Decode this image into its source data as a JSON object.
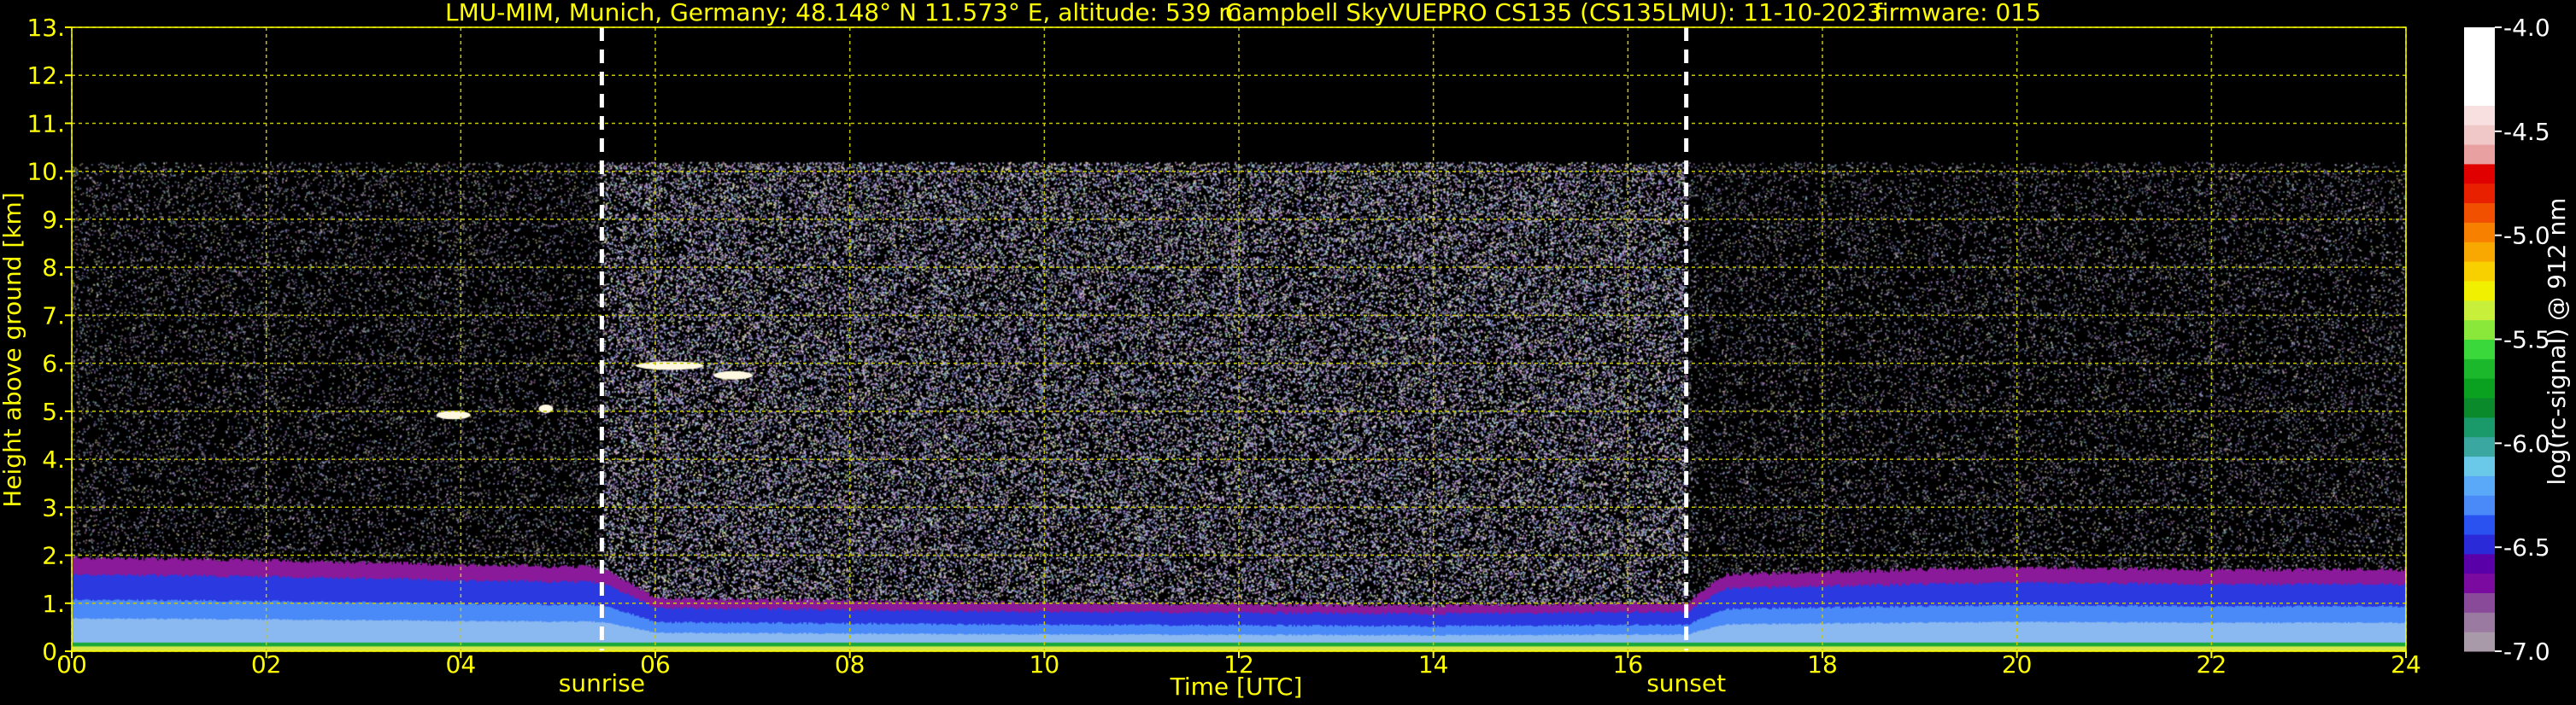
{
  "chart_data": {
    "type": "heatmap",
    "title": {
      "location": "LMU-MIM, Munich, Germany; 48.148° N 11.573° E, altitude: 539 m",
      "instrument": "Campbell SkyVUEPRO CS135 (CS135LMU): 11-10-2023",
      "firmware": "firmware: 015"
    },
    "xlabel": "Time [UTC]",
    "ylabel": "Height above ground [km]",
    "x_range": [
      0,
      24
    ],
    "y_range": [
      0,
      13
    ],
    "x_ticks": [
      "00",
      "02",
      "04",
      "06",
      "08",
      "10",
      "12",
      "14",
      "16",
      "18",
      "20",
      "22",
      "24"
    ],
    "y_ticks": [
      "0.",
      "1.",
      "2.",
      "3.",
      "4.",
      "5.",
      "6.",
      "7.",
      "8.",
      "9.",
      "10.",
      "11.",
      "12.",
      "13."
    ],
    "grid": true,
    "markers": [
      {
        "label": "sunrise",
        "x": 5.45
      },
      {
        "label": "sunset",
        "x": 16.6
      }
    ],
    "colorbar": {
      "label": "log(rc-signal) @ 912 nm",
      "ticks": [
        "-4.0",
        "-4.5",
        "-5.0",
        "-5.5",
        "-6.0",
        "-6.5",
        "-7.0"
      ],
      "range": [
        -7.0,
        -4.0
      ],
      "colors": [
        "#a89aa8",
        "#9a7aa0",
        "#8a4a9a",
        "#7a0aa0",
        "#5a00a8",
        "#2a2ad8",
        "#2a52f0",
        "#4a8af8",
        "#5aa8f8",
        "#6ac8e8",
        "#3aa8a0",
        "#1a9a6a",
        "#0a8a2a",
        "#0aa020",
        "#1ab82a",
        "#3ad83a",
        "#8ae83a",
        "#c8f03a",
        "#f0f000",
        "#f8d000",
        "#f8a800",
        "#f88000",
        "#f05000",
        "#e82000",
        "#e00000",
        "#e8a0a0",
        "#f0c8c8",
        "#f8e0e0",
        "#ffffff",
        "#ffffff",
        "#ffffff",
        "#ffffff"
      ]
    },
    "noise_top_km": 10.2,
    "boundary_layer": [
      {
        "t": 0,
        "top": 1.95
      },
      {
        "t": 2,
        "top": 1.9
      },
      {
        "t": 4,
        "top": 1.8
      },
      {
        "t": 5.45,
        "top": 1.75
      },
      {
        "t": 6,
        "top": 1.1
      },
      {
        "t": 10,
        "top": 1.0
      },
      {
        "t": 14,
        "top": 0.95
      },
      {
        "t": 16.6,
        "top": 1.0
      },
      {
        "t": 17,
        "top": 1.6
      },
      {
        "t": 20,
        "top": 1.75
      },
      {
        "t": 22,
        "top": 1.7
      },
      {
        "t": 24,
        "top": 1.7
      }
    ],
    "clouds": [
      {
        "t0": 3.75,
        "t1": 4.1,
        "h": 4.92
      },
      {
        "t0": 4.8,
        "t1": 4.95,
        "h": 5.05
      },
      {
        "t0": 5.8,
        "t1": 6.5,
        "h": 5.95
      },
      {
        "t0": 6.6,
        "t1": 7.0,
        "h": 5.75
      }
    ]
  }
}
